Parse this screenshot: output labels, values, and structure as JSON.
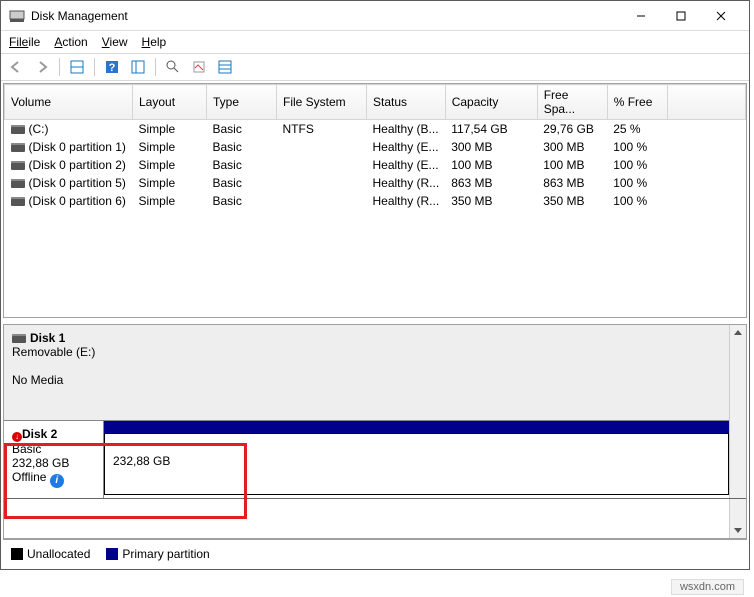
{
  "title": "Disk Management",
  "menubar": [
    "File",
    "Action",
    "View",
    "Help"
  ],
  "columns": [
    "Volume",
    "Layout",
    "Type",
    "File System",
    "Status",
    "Capacity",
    "Free Spa...",
    "% Free"
  ],
  "volumes": [
    {
      "name": "(C:)",
      "layout": "Simple",
      "type": "Basic",
      "fs": "NTFS",
      "status": "Healthy (B...",
      "cap": "117,54 GB",
      "free": "29,76 GB",
      "pct": "25 %"
    },
    {
      "name": "(Disk 0 partition 1)",
      "layout": "Simple",
      "type": "Basic",
      "fs": "",
      "status": "Healthy (E...",
      "cap": "300 MB",
      "free": "300 MB",
      "pct": "100 %"
    },
    {
      "name": "(Disk 0 partition 2)",
      "layout": "Simple",
      "type": "Basic",
      "fs": "",
      "status": "Healthy (E...",
      "cap": "100 MB",
      "free": "100 MB",
      "pct": "100 %"
    },
    {
      "name": "(Disk 0 partition 5)",
      "layout": "Simple",
      "type": "Basic",
      "fs": "",
      "status": "Healthy (R...",
      "cap": "863 MB",
      "free": "863 MB",
      "pct": "100 %"
    },
    {
      "name": "(Disk 0 partition 6)",
      "layout": "Simple",
      "type": "Basic",
      "fs": "",
      "status": "Healthy (R...",
      "cap": "350 MB",
      "free": "350 MB",
      "pct": "100 %"
    }
  ],
  "disk1": {
    "title": "Disk 1",
    "sub1": "Removable (E:)",
    "sub2": "No Media"
  },
  "disk2": {
    "title": "Disk 2",
    "sub1": "Basic",
    "sub2": "232,88 GB",
    "sub3": "Offline",
    "part_size": "232,88 GB"
  },
  "legend": {
    "unalloc": "Unallocated",
    "primary": "Primary partition"
  },
  "credit": "wsxdn.com"
}
